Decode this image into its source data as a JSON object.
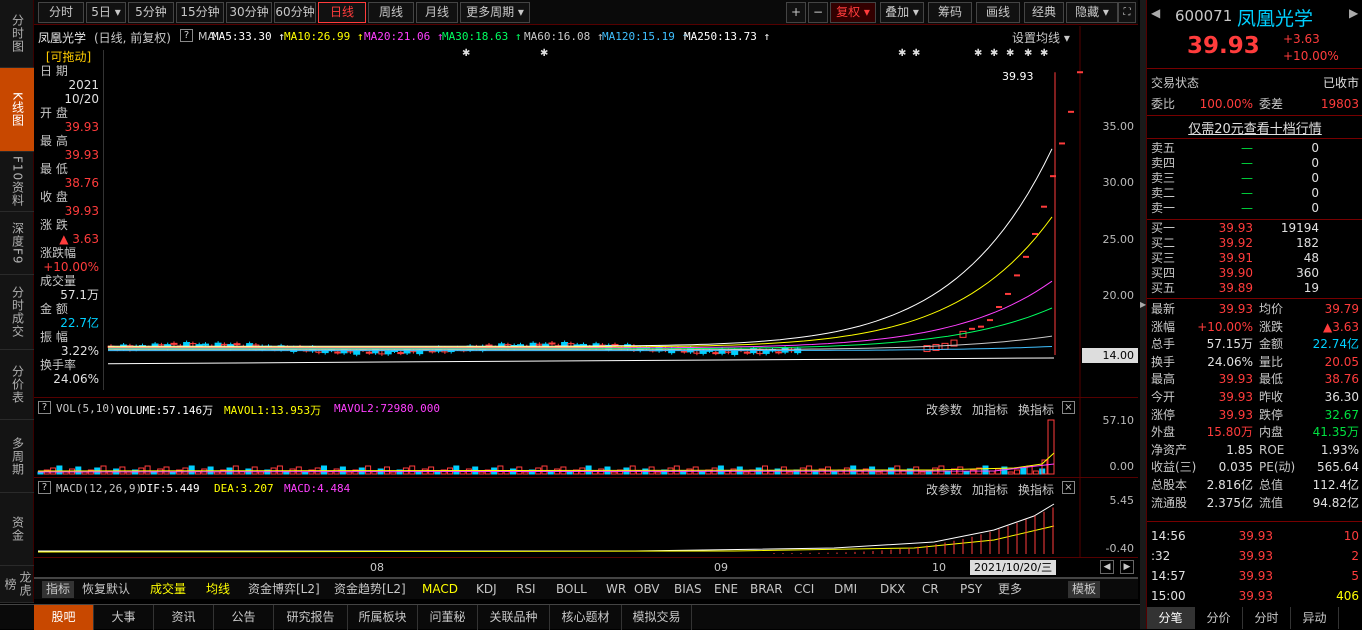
{
  "leftnav": [
    {
      "label": "分时图",
      "active": false
    },
    {
      "label": "K线图",
      "active": true
    },
    {
      "label": "F10资料",
      "active": false
    },
    {
      "label": "深度F9",
      "active": false
    },
    {
      "label": "分时成交",
      "active": false
    },
    {
      "label": "分价表",
      "active": false
    },
    {
      "label": "多周期",
      "active": false
    },
    {
      "label": "资金",
      "active": false
    },
    {
      "label": "龙虎榜",
      "active": false
    }
  ],
  "toolbar": {
    "periods": [
      "分时",
      "5日",
      "5分钟",
      "15分钟",
      "30分钟",
      "60分钟",
      "日线",
      "周线",
      "月线",
      "更多周期"
    ],
    "active_period": "日线",
    "right": [
      "+",
      "−",
      "复权",
      "叠加",
      "筹码",
      "画线",
      "经典",
      "隐藏"
    ]
  },
  "chart": {
    "stock_name": "凤凰光学",
    "mode": "(日线, 前复权)",
    "ma_label": "MA",
    "ma": [
      {
        "text": "MA5:33.30",
        "color": "#ffffff"
      },
      {
        "text": "MA10:26.99",
        "color": "#ffff00"
      },
      {
        "text": "MA20:21.06",
        "color": "#ff40ff"
      },
      {
        "text": "MA30:18.63",
        "color": "#00ff60"
      },
      {
        "text": "MA60:16.08",
        "color": "#c8c8c8"
      },
      {
        "text": "MA120:15.19",
        "color": "#40c0ff"
      },
      {
        "text": "MA250:13.73",
        "color": "#ffffff"
      }
    ],
    "settings_label": "设置均线",
    "price_axis": [
      "35.00",
      "30.00",
      "25.00",
      "20.00",
      "14.00"
    ],
    "last_price_label": "39.93",
    "current_price_tag": "14.00"
  },
  "infobox": {
    "drag": "[可拖动]",
    "date_label": "日  期",
    "date_year": "2021",
    "date_md": "10/20",
    "open_label": "开  盘",
    "open": "39.93",
    "high_label": "最  高",
    "high": "39.93",
    "low_label": "最  低",
    "low": "38.76",
    "close_label": "收  盘",
    "close": "39.93",
    "change_label": "涨  跌",
    "change": "▲ 3.63",
    "pct_label": "涨跌幅",
    "pct": "+10.00%",
    "vol_label": "成交量",
    "vol": "57.1万",
    "amt_label": "金  额",
    "amt": "22.7亿",
    "amp_label": "振  幅",
    "amp": "3.22%",
    "turn_label": "换手率",
    "turn": "24.06%"
  },
  "volume": {
    "label": "VOL(5,10)",
    "volume": "VOLUME:57.146万",
    "mavol1": "MAVOL1:13.953万",
    "mavol2": "MAVOL2:72980.000",
    "axis_top": "57.10",
    "axis_bot": "0.00",
    "actions": [
      "改参数",
      "加指标",
      "换指标"
    ]
  },
  "macd": {
    "label": "MACD(12,26,9)",
    "dif": "DIF:5.449",
    "dea": "DEA:3.207",
    "macd": "MACD:4.484",
    "axis_top": "5.45",
    "axis_bot": "-0.40",
    "actions": [
      "改参数",
      "加指标",
      "换指标"
    ],
    "months": [
      "08",
      "09",
      "10"
    ],
    "date_tag": "2021/10/20/三"
  },
  "bottombar": [
    "指标",
    "恢复默认",
    "成交量",
    "均线",
    "资金博弈[L2]",
    "资金趋势[L2]",
    "MACD",
    "KDJ",
    "RSI",
    "BOLL",
    "WR",
    "OBV",
    "BIAS",
    "ENE",
    "BRAR",
    "CCI",
    "DMI",
    "DKX",
    "CR",
    "PSY",
    "更多",
    "模板"
  ],
  "footer": [
    "股吧",
    "大事",
    "资讯",
    "公告",
    "研究报告",
    "所属板块",
    "问董秘",
    "关联品种",
    "核心题材",
    "模拟交易"
  ],
  "quote": {
    "code": "600071",
    "name": "凤凰光学",
    "price": "39.93",
    "change": "+3.63",
    "pct": "+10.00%",
    "status_label": "交易状态",
    "status": "已收市",
    "wb_label": "委比",
    "wb": "100.00%",
    "wc_label": "委差",
    "wc": "19803",
    "ten_level": "仅需20元查看十档行情",
    "sell": [
      {
        "label": "卖五",
        "price": "—",
        "vol": "0"
      },
      {
        "label": "卖四",
        "price": "—",
        "vol": "0"
      },
      {
        "label": "卖三",
        "price": "—",
        "vol": "0"
      },
      {
        "label": "卖二",
        "price": "—",
        "vol": "0"
      },
      {
        "label": "卖一",
        "price": "—",
        "vol": "0"
      }
    ],
    "buy": [
      {
        "label": "买一",
        "price": "39.93",
        "vol": "19194"
      },
      {
        "label": "买二",
        "price": "39.92",
        "vol": "182"
      },
      {
        "label": "买三",
        "price": "39.91",
        "vol": "48"
      },
      {
        "label": "买四",
        "price": "39.90",
        "vol": "360"
      },
      {
        "label": "买五",
        "price": "39.89",
        "vol": "19"
      }
    ],
    "stats": [
      {
        "l1": "最新",
        "v1": "39.93",
        "c1": "red",
        "l2": "均价",
        "v2": "39.79",
        "c2": "red"
      },
      {
        "l1": "涨幅",
        "v1": "+10.00%",
        "c1": "red",
        "l2": "涨跌",
        "v2": "▲3.63",
        "c2": "red"
      },
      {
        "l1": "总手",
        "v1": "57.15万",
        "c1": "white",
        "l2": "金额",
        "v2": "22.74亿",
        "c2": "cyan"
      },
      {
        "l1": "换手",
        "v1": "24.06%",
        "c1": "white",
        "l2": "量比",
        "v2": "20.05",
        "c2": "red"
      },
      {
        "l1": "最高",
        "v1": "39.93",
        "c1": "red",
        "l2": "最低",
        "v2": "38.76",
        "c2": "red"
      },
      {
        "l1": "今开",
        "v1": "39.93",
        "c1": "red",
        "l2": "昨收",
        "v2": "36.30",
        "c2": "white"
      },
      {
        "l1": "涨停",
        "v1": "39.93",
        "c1": "red",
        "l2": "跌停",
        "v2": "32.67",
        "c2": "green"
      },
      {
        "l1": "外盘",
        "v1": "15.80万",
        "c1": "red",
        "l2": "内盘",
        "v2": "41.35万",
        "c2": "green"
      },
      {
        "l1": "净资产",
        "v1": "1.85",
        "c1": "white",
        "l2": "ROE",
        "v2": "1.93%",
        "c2": "white"
      },
      {
        "l1": "收益(三)",
        "v1": "0.035",
        "c1": "white",
        "l2": "PE(动)",
        "v2": "565.64",
        "c2": "white"
      },
      {
        "l1": "总股本",
        "v1": "2.816亿",
        "c1": "white",
        "l2": "总值",
        "v2": "112.4亿",
        "c2": "white"
      },
      {
        "l1": "流通股",
        "v1": "2.375亿",
        "c1": "white",
        "l2": "流值",
        "v2": "94.82亿",
        "c2": "white"
      }
    ],
    "ticks": [
      {
        "time": "14:56",
        "price": "39.93",
        "vol": "10"
      },
      {
        "time": ":32",
        "price": "39.93",
        "vol": "2"
      },
      {
        "time": "14:57",
        "price": "39.93",
        "vol": "5"
      },
      {
        "time": "15:00",
        "price": "39.93",
        "vol": "406"
      }
    ],
    "tabs": [
      "分笔",
      "分价",
      "分时",
      "异动"
    ],
    "active_tab": "分笔"
  }
}
